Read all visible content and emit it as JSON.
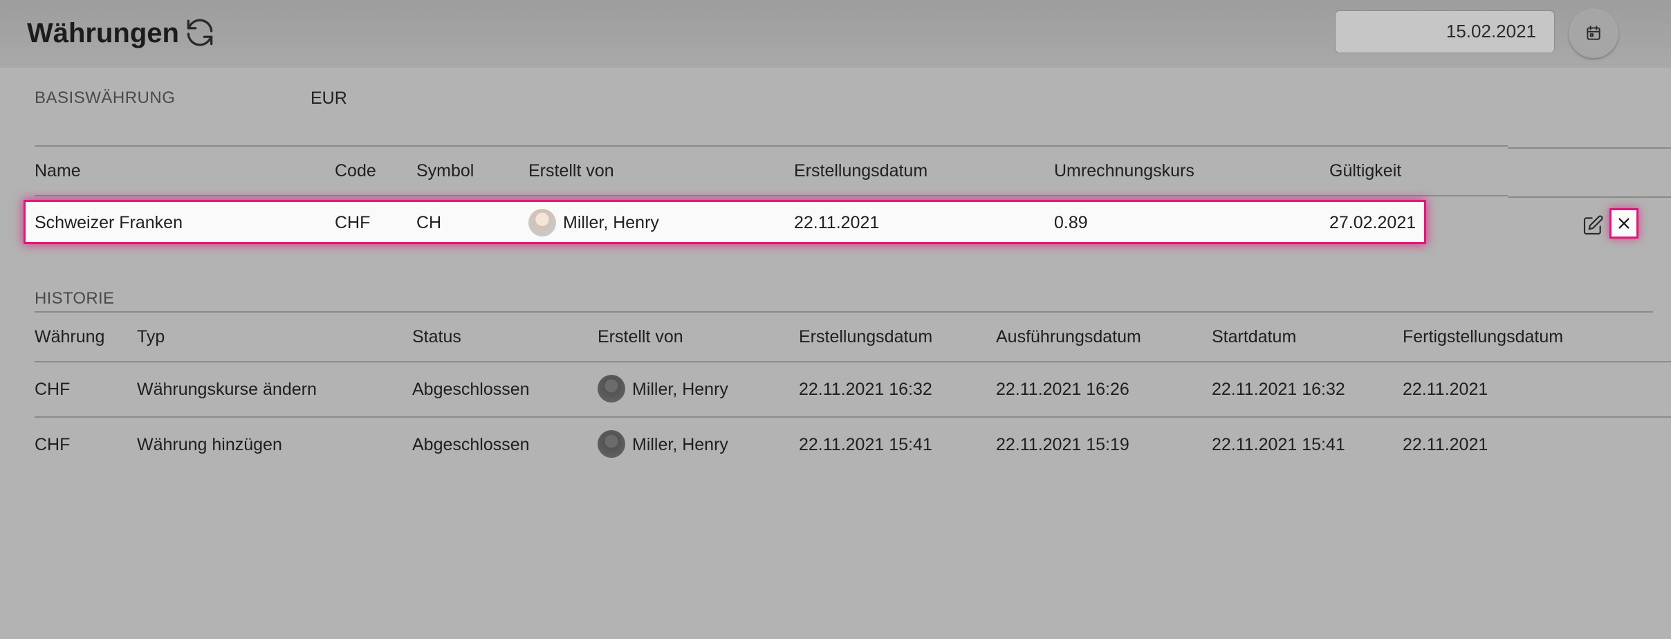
{
  "header": {
    "title": "Währungen",
    "date_value": "15.02.2021",
    "icons": {
      "refresh": "refresh-icon",
      "calendar": "calendar-icon"
    }
  },
  "base_currency": {
    "label": "BASISWÄHRUNG",
    "value": "EUR"
  },
  "currencies": {
    "columns": [
      "Name",
      "Code",
      "Symbol",
      "Erstellt von",
      "Erstellungsdatum",
      "Umrechnungskurs",
      "Gültigkeit"
    ],
    "rows": [
      {
        "name": "Schweizer Franken",
        "code": "CHF",
        "symbol": "CH",
        "created_by": "Miller, Henry",
        "created_date": "22.11.2021",
        "rate": "0.89",
        "validity": "27.02.2021",
        "selected": true
      }
    ],
    "row_actions": [
      "edit-icon",
      "close-icon"
    ]
  },
  "history": {
    "label": "HISTORIE",
    "columns": [
      "Währung",
      "Typ",
      "Status",
      "Erstellt von",
      "Erstellungsdatum",
      "Ausführungsdatum",
      "Startdatum",
      "Fertigstellungsdatum"
    ],
    "rows": [
      {
        "currency": "CHF",
        "type": "Währungskurse ändern",
        "status": "Abgeschlossen",
        "created_by": "Miller, Henry",
        "created": "22.11.2021 16:32",
        "executed": "22.11.2021 16:26",
        "start": "22.11.2021 16:32",
        "finished": "22.11.2021"
      },
      {
        "currency": "CHF",
        "type": "Währung hinzügen",
        "status": "Abgeschlossen",
        "created_by": "Miller, Henry",
        "created": "22.11.2021 15:41",
        "executed": "22.11.2021 15:19",
        "start": "22.11.2021 15:41",
        "finished": "22.11.2021"
      }
    ]
  },
  "colors": {
    "background": "#b3b3b3",
    "highlight": "#e0177a",
    "row_selected": "#fafafa"
  }
}
